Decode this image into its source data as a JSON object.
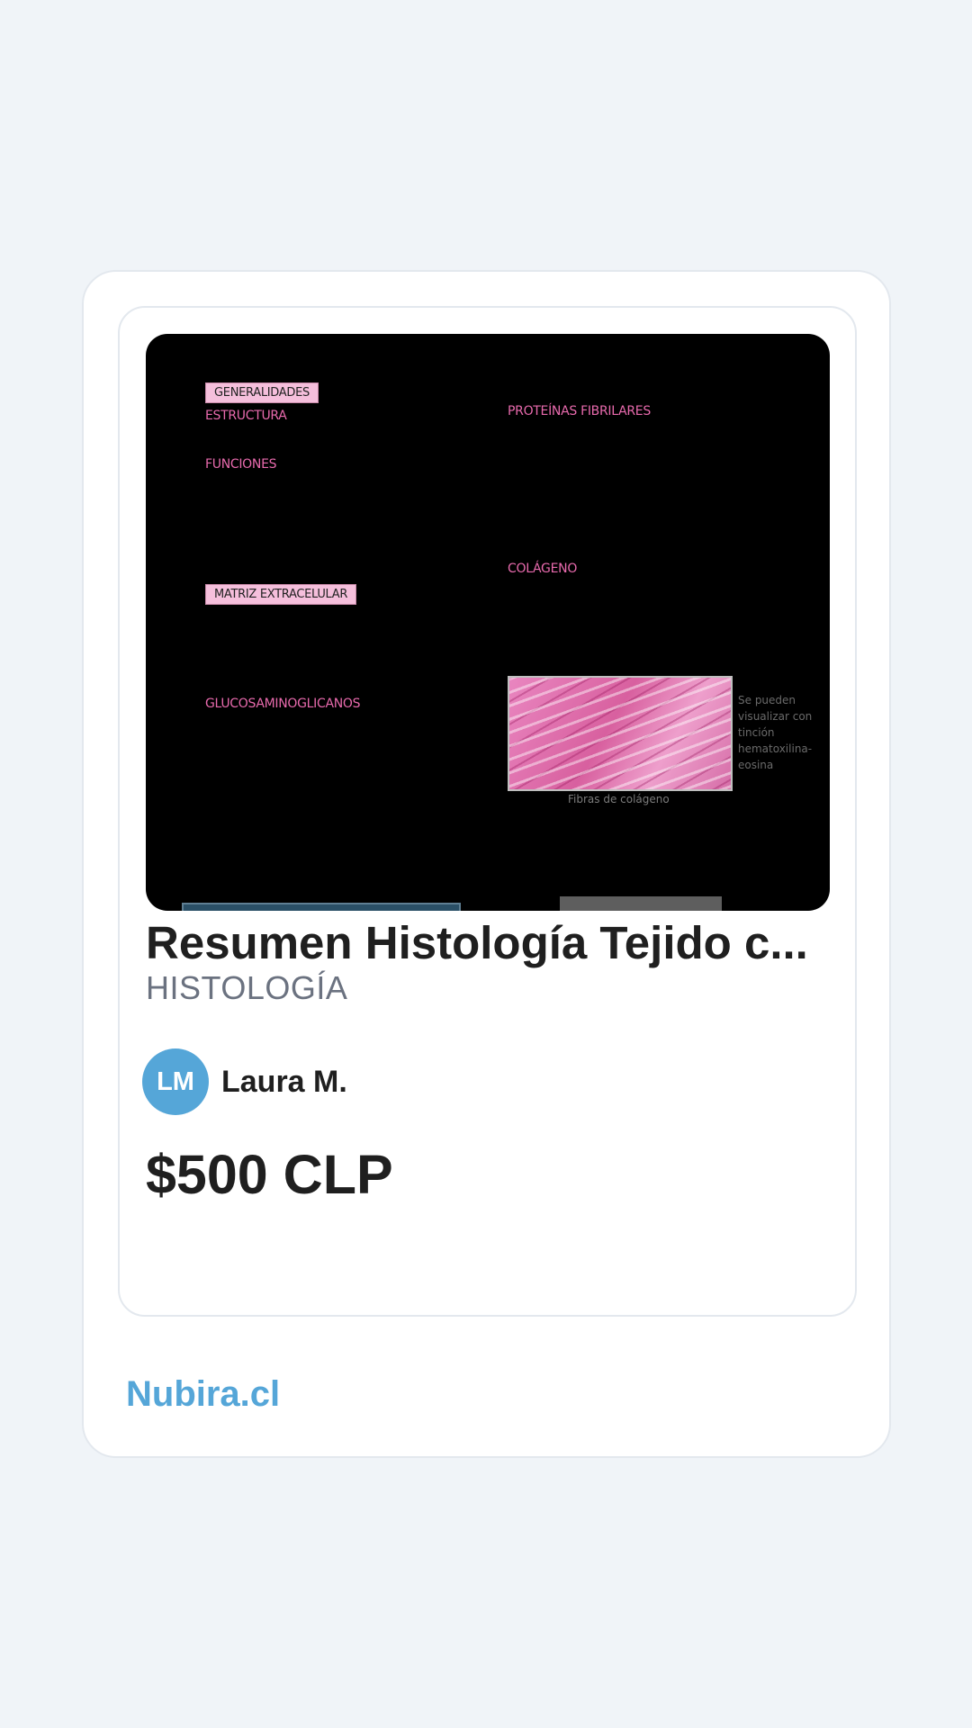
{
  "product": {
    "title": "Resumen Histología Tejido c...",
    "category": "HISTOLOGÍA",
    "author_initials": "LM",
    "author_name": "Laura M.",
    "price": "$500 CLP"
  },
  "preview": {
    "generalidades": "GENERALIDADES",
    "estructura": "ESTRUCTURA",
    "funciones": "FUNCIONES",
    "matriz": "MATRIZ EXTRACELULAR",
    "glucosaminoglicanos": "GLUCOSAMINOGLICANOS",
    "proteinas": "PROTEÍNAS FIBRILARES",
    "colageno": "COLÁGENO",
    "side_note": "Se pueden visualizar con tinción hematoxilina-eosina",
    "caption": "Fibras de colágeno"
  },
  "footer": {
    "brand": "Nubira.cl"
  },
  "colors": {
    "accent": "#55a6d8",
    "slide_pink": "#e86aad"
  }
}
